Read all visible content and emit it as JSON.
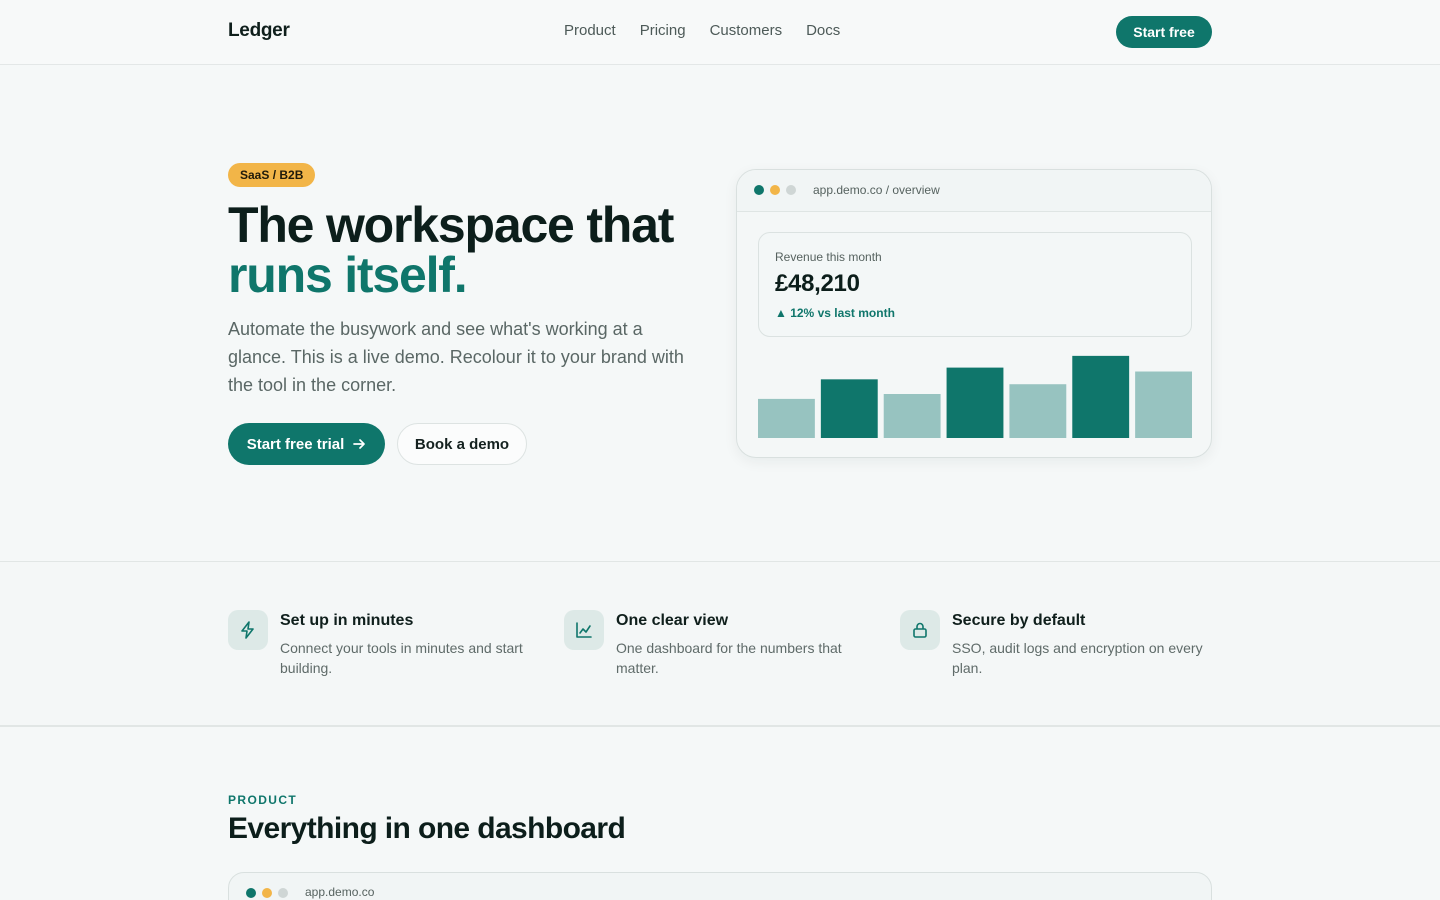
{
  "nav": {
    "logo": "Ledger",
    "links": [
      "Product",
      "Pricing",
      "Customers",
      "Docs"
    ],
    "cta": "Start free"
  },
  "hero": {
    "badge": "SaaS / B2B",
    "title_line1": "The workspace that",
    "title_line2": "runs itself.",
    "subtitle": "Automate the busywork and see what's working at a glance. This is a live demo. Recolour it to your brand with the tool in the corner.",
    "primary_button": "Start free trial",
    "secondary_button": "Book a demo"
  },
  "mockup": {
    "url": "app.demo.co / overview",
    "revenue_label": "Revenue this month",
    "revenue_value": "£48,210",
    "revenue_delta": "▲ 12% vs last month"
  },
  "chart_data": {
    "type": "bar",
    "categories": [
      "",
      "",
      "",
      "",
      "",
      "",
      ""
    ],
    "values": [
      40,
      60,
      45,
      72,
      55,
      84,
      68
    ],
    "highlighted": [
      false,
      true,
      false,
      true,
      false,
      true,
      false
    ],
    "ylim": [
      0,
      90
    ],
    "title": "",
    "xlabel": "",
    "ylabel": "",
    "grid": false,
    "colors": {
      "highlight": "#0f766b",
      "muted": "#97c3c0"
    }
  },
  "features": [
    {
      "icon": "lightning-icon",
      "title": "Set up in minutes",
      "desc": "Connect your tools in minutes and start building."
    },
    {
      "icon": "line-chart-icon",
      "title": "One clear view",
      "desc": "One dashboard for the numbers that matter."
    },
    {
      "icon": "lock-icon",
      "title": "Secure by default",
      "desc": "SSO, audit logs and encryption on every plan."
    }
  ],
  "product": {
    "eyebrow": "PRODUCT",
    "title": "Everything in one dashboard",
    "url": "app.demo.co"
  },
  "colors": {
    "brand": "#0f766b",
    "badge": "#f2b548",
    "window_dots": [
      "#0f766b",
      "#f2b548",
      "#cfd6d5"
    ]
  }
}
